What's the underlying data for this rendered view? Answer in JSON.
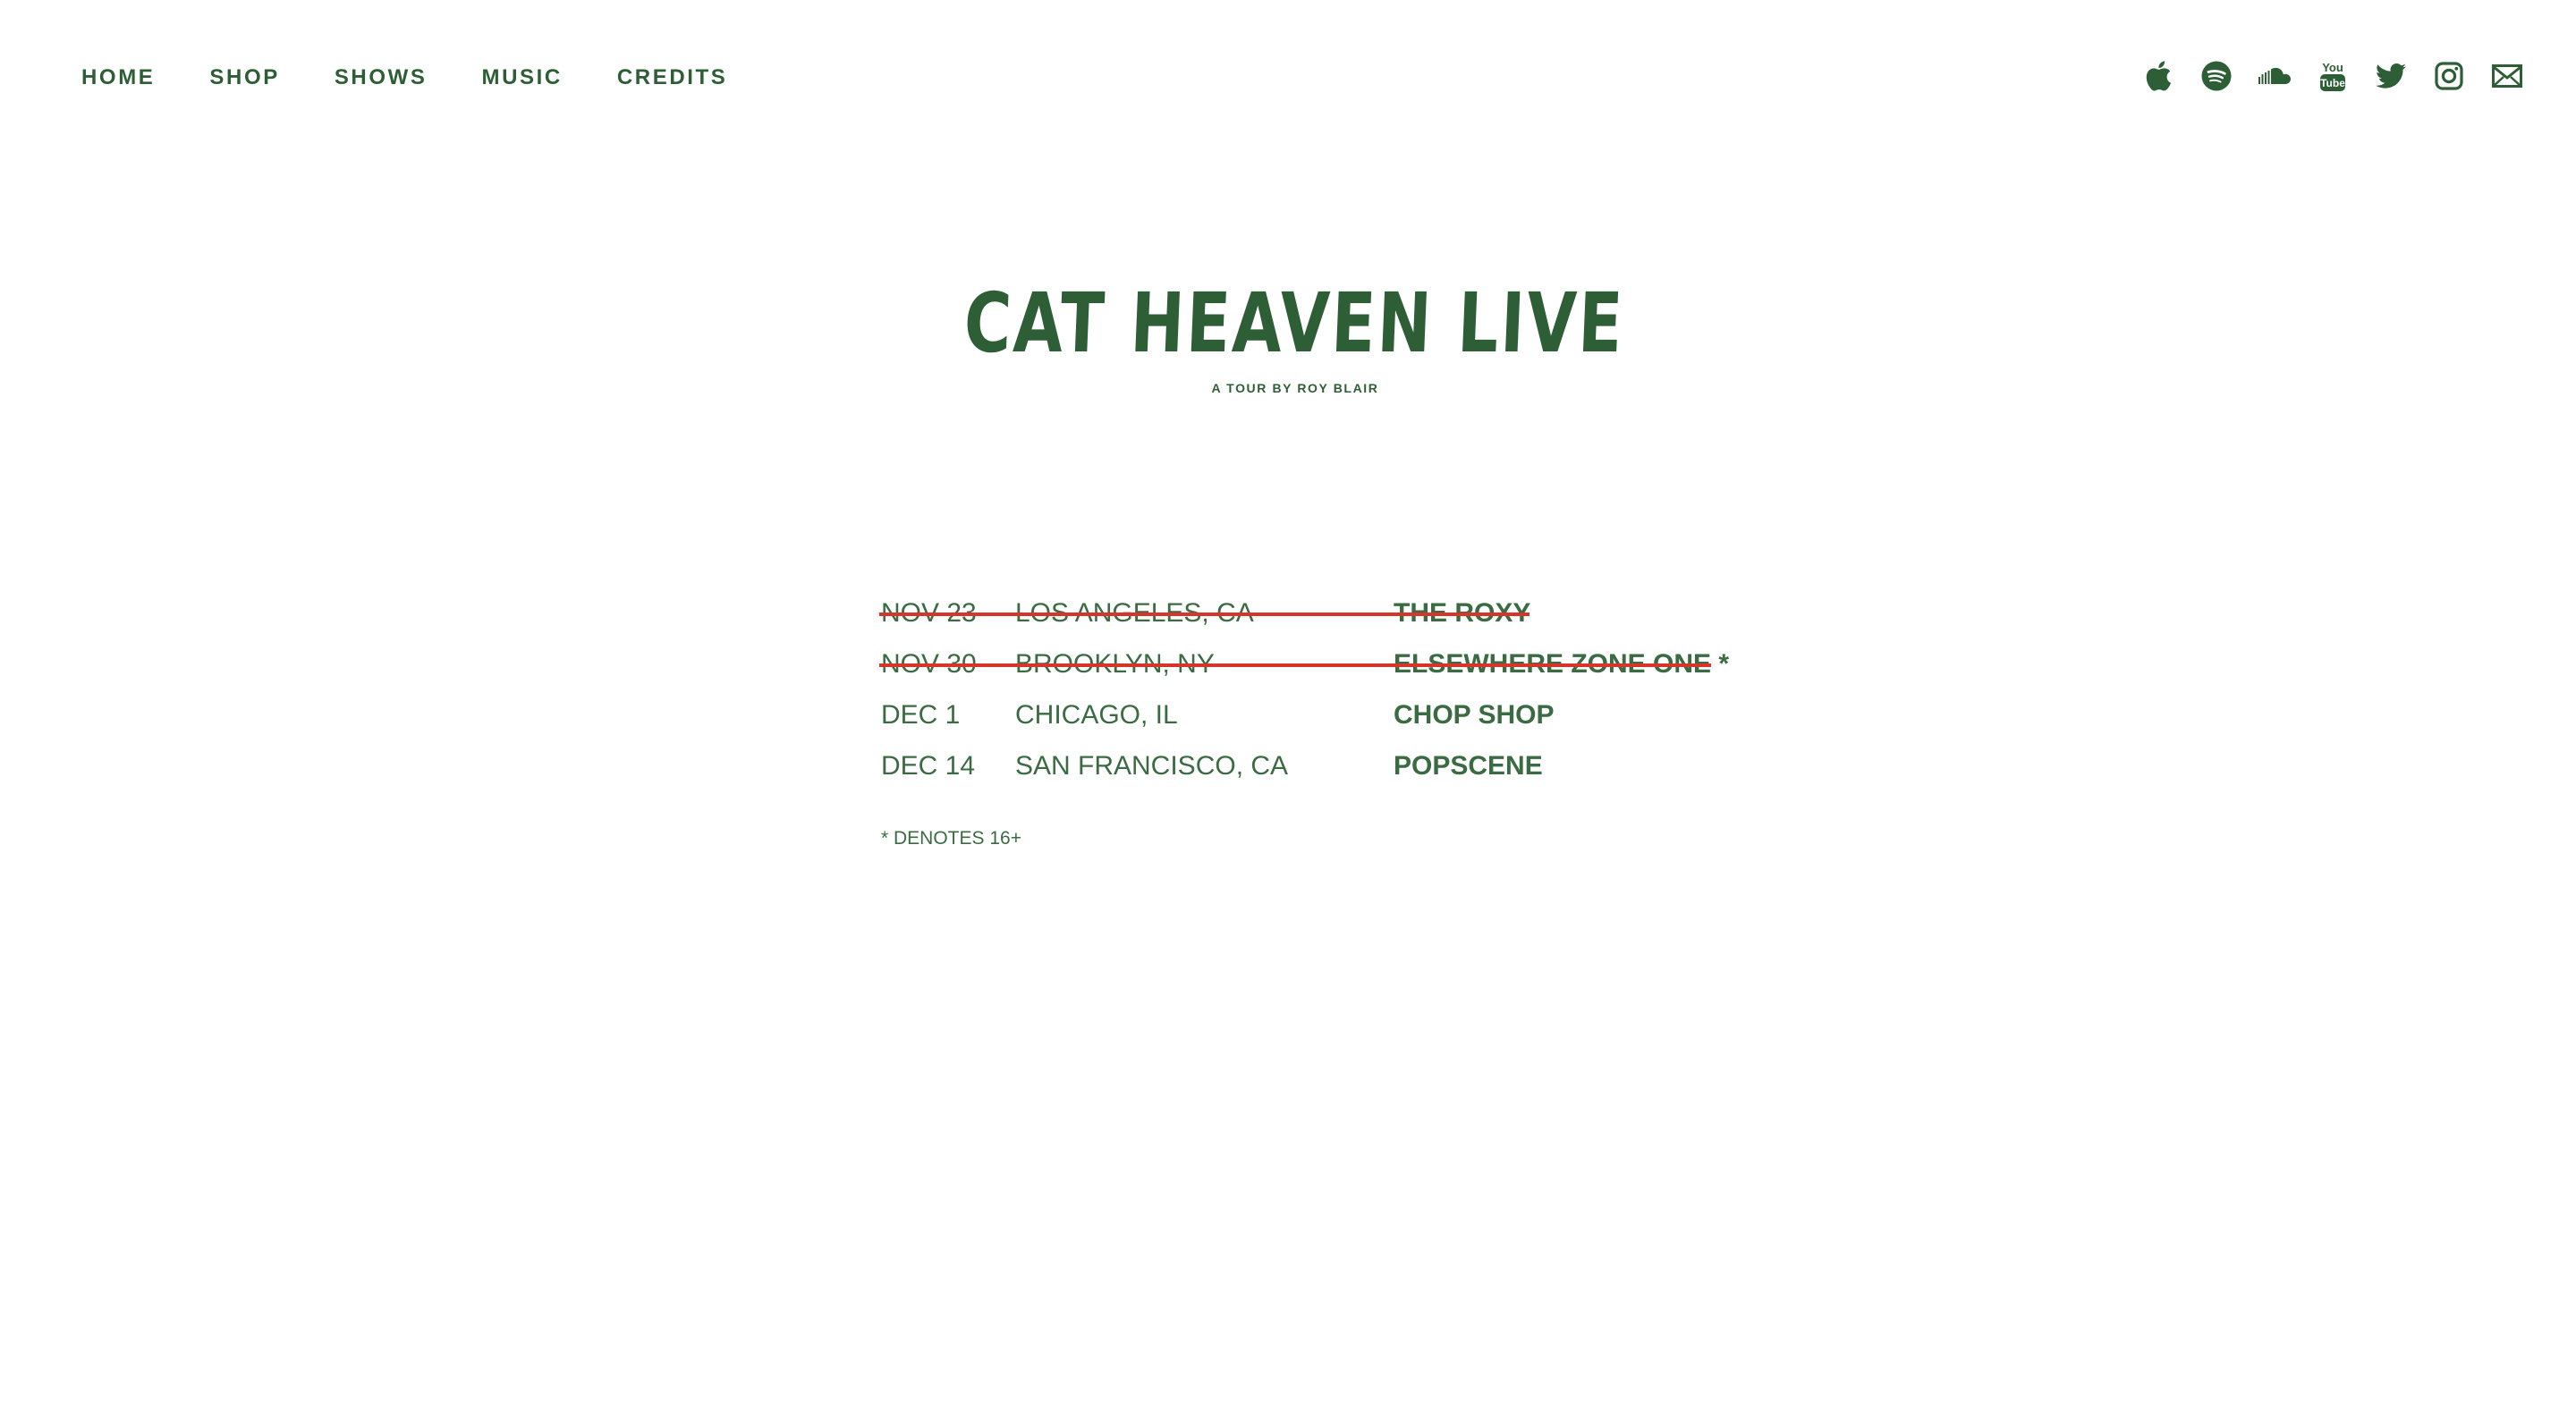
{
  "nav": {
    "items": [
      {
        "label": "HOME"
      },
      {
        "label": "SHOP"
      },
      {
        "label": "SHOWS"
      },
      {
        "label": "MUSIC"
      },
      {
        "label": "CREDITS"
      }
    ]
  },
  "social": {
    "icons": [
      "apple-music-icon",
      "spotify-icon",
      "soundcloud-icon",
      "youtube-icon",
      "twitter-icon",
      "instagram-icon",
      "email-icon"
    ],
    "youtube_text_top": "You",
    "youtube_text_bottom": "Tube"
  },
  "hero": {
    "title": "CAT HEAVEN LIVE",
    "subtitle": "A TOUR BY ROY BLAIR"
  },
  "shows": [
    {
      "date": "NOV 23",
      "city": "LOS ANGELES, CA",
      "venue": "THE ROXY",
      "cancelled": true
    },
    {
      "date": "NOV 30",
      "city": "BROOKLYN, NY",
      "venue": "ELSEWHERE ZONE ONE *",
      "cancelled": true
    },
    {
      "date": "DEC 1",
      "city": "CHICAGO, IL",
      "venue": "CHOP SHOP",
      "cancelled": false
    },
    {
      "date": "DEC 14",
      "city": "SAN FRANCISCO, CA",
      "venue": "POPSCENE",
      "cancelled": false
    }
  ],
  "note": "* DENOTES 16+",
  "colors": {
    "brand_green": "#2d5e35",
    "strike_red": "#d6352a",
    "background": "#ffffff"
  }
}
